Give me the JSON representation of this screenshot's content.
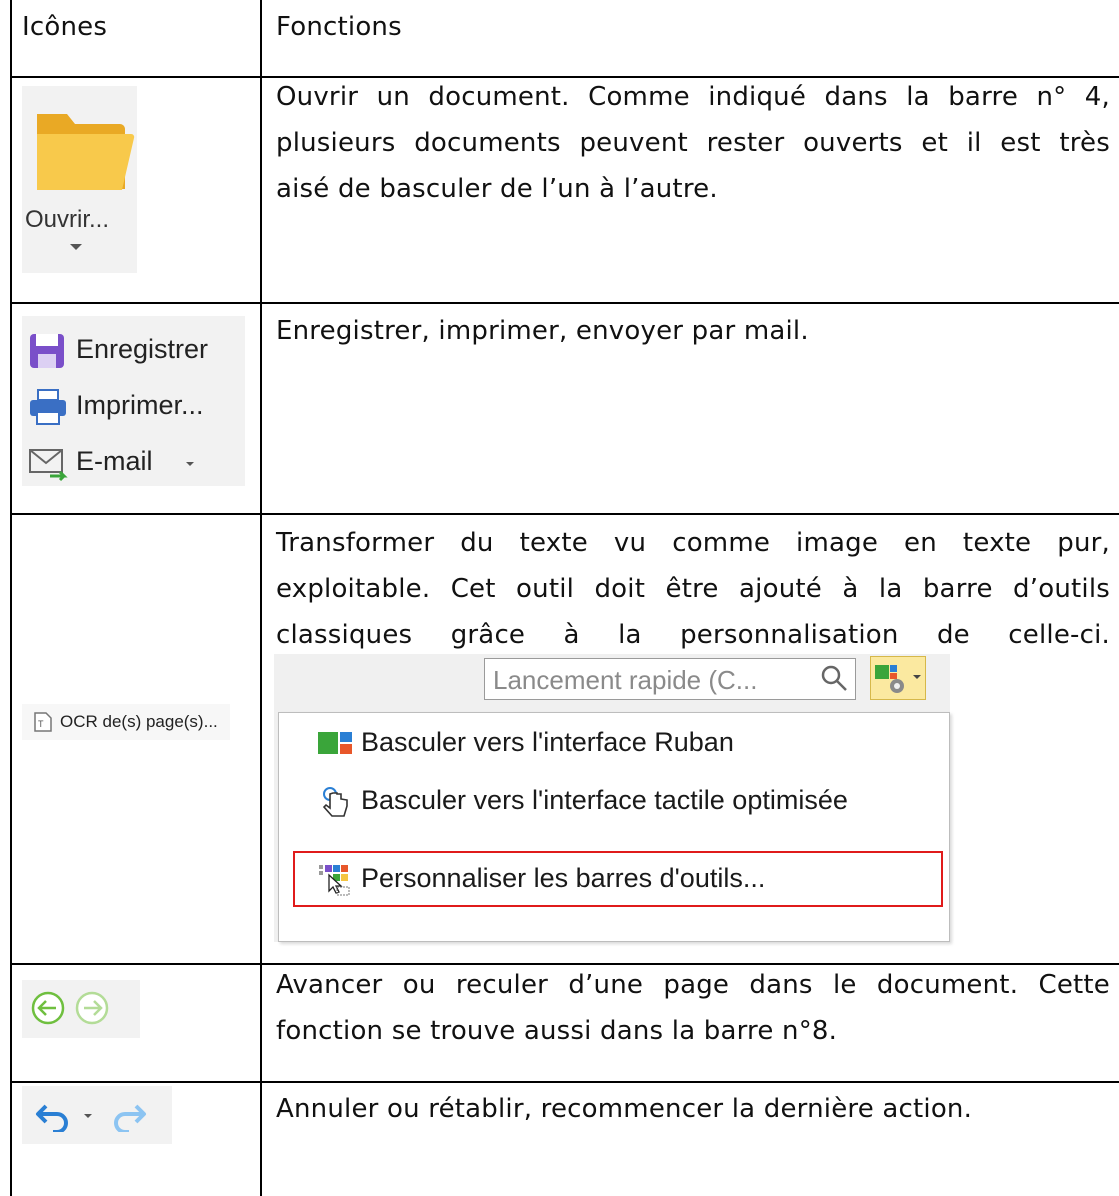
{
  "table": {
    "header": {
      "col1": "Icônes",
      "col2": "Fonctions"
    },
    "rows": [
      {
        "icons": {
          "open_label": "Ouvrir..."
        },
        "text_lines": [
          "Ouvrir un document. Comme indiqué dans la barre n° 4,",
          "plusieurs documents peuvent rester ouverts et il est très",
          "aisé de basculer de l’un à l’autre."
        ]
      },
      {
        "icons": {
          "save_label": "Enregistrer",
          "print_label": "Imprimer...",
          "email_label": "E-mail"
        },
        "text_lines": [
          "Enregistrer, imprimer, envoyer par mail."
        ]
      },
      {
        "icons": {
          "ocr_label": "OCR de(s) page(s)..."
        },
        "text_lines": [
          "Transformer du texte vu comme image en texte pur,",
          "exploitable. Cet outil doit être ajouté à la barre d’outils",
          "classiques grâce à la personnalisation de celle-ci."
        ],
        "screenshot": {
          "search_placeholder": "Lancement rapide (C...",
          "menu_items": [
            "Basculer vers l'interface Ruban",
            "Basculer vers l'interface tactile optimisée",
            "Personnaliser les barres d'outils..."
          ],
          "highlighted_index": 2,
          "highlight_color": "#e01b1b"
        }
      },
      {
        "icons": {
          "back": "back-arrow-icon",
          "forward": "forward-arrow-icon"
        },
        "text_lines": [
          "Avancer ou reculer d’une page dans le document. Cette",
          "fonction se trouve aussi dans la barre n°8."
        ]
      },
      {
        "icons": {
          "undo": "undo-icon",
          "redo": "redo-icon"
        },
        "text_lines": [
          "Annuler ou rétablir, recommencer la dernière action."
        ]
      }
    ]
  },
  "colors": {
    "folder": "#f5c542",
    "save": "#7a4fc9",
    "arrow_green": "#6fbf3f",
    "undo_blue": "#2a7fd4",
    "redo_blue": "#8cc4f2"
  }
}
